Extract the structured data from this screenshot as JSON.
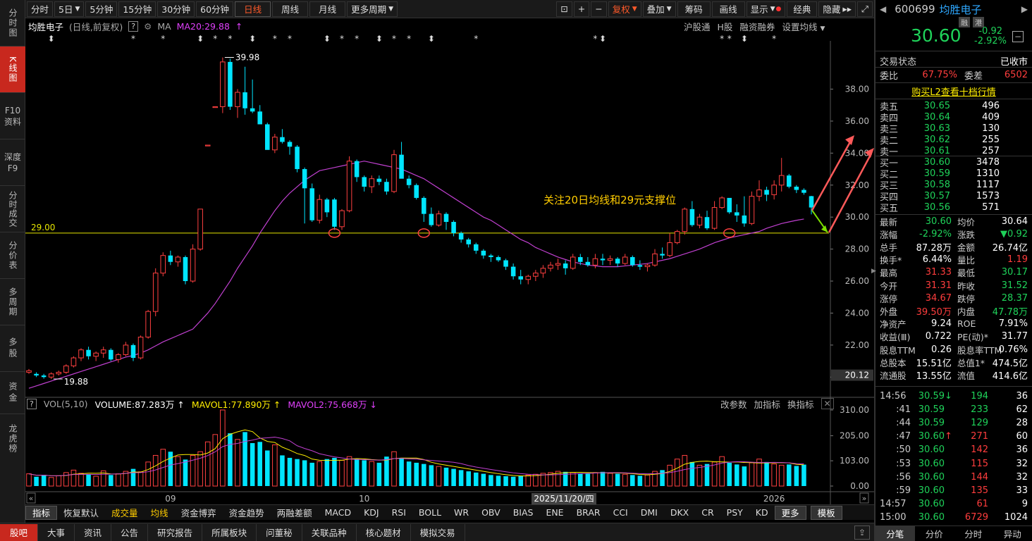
{
  "nav": [
    {
      "label": "分时图",
      "active": false
    },
    {
      "label": "K线图",
      "active": true
    },
    {
      "label": "F10资料",
      "active": false
    },
    {
      "label": "深度F9",
      "active": false
    },
    {
      "label": "分时成交",
      "active": false
    },
    {
      "label": "分价表",
      "active": false
    },
    {
      "label": "多周期",
      "active": false
    },
    {
      "label": "多股",
      "active": false
    },
    {
      "label": "资金",
      "active": false
    },
    {
      "label": "龙虎榜",
      "active": false
    }
  ],
  "toolbar": {
    "periods": [
      "分时",
      "5日",
      "5分钟",
      "15分钟",
      "30分钟",
      "60分钟",
      "日线",
      "周线",
      "月线",
      "更多周期"
    ],
    "active_period": "日线",
    "right": [
      "复权",
      "叠加",
      "筹码",
      "画线",
      "显示",
      "经典",
      "隐藏"
    ]
  },
  "stock": {
    "name": "均胜电子",
    "mode": "(日线,前复权)",
    "ma_label": "MA",
    "ma20": "MA20:29.88",
    "ma_color": "#e040fb",
    "options": [
      "沪股通",
      "H股",
      "融资融券",
      "设置均线"
    ]
  },
  "annotations": {
    "high": "39.98",
    "low": "19.88",
    "support": "29.00",
    "current": "20.12",
    "text": "关注20日均线和29元支撑位"
  },
  "vol": {
    "label": "VOL(5,10)",
    "volume": "VOLUME:87.283万",
    "mavol1": "MAVOL1:77.890万",
    "mavol2": "MAVOL2:75.668万",
    "options": [
      "改参数",
      "加指标",
      "换指标"
    ]
  },
  "xlabels": {
    "m09": "09",
    "m10": "10",
    "m11": "11",
    "date": "2025/11/20/四",
    "y2026": "2026"
  },
  "chart_data": {
    "type": "candlestick",
    "y_ticks": [
      38,
      36,
      34,
      32,
      30,
      28,
      26,
      24,
      22,
      20
    ],
    "ylim": [
      19,
      40.4
    ],
    "vol_ticks": [
      "310.00",
      "205.00",
      "103.00",
      "0.00"
    ],
    "vol_max": 310,
    "candles": [
      [
        20.3,
        20.5,
        20.2,
        20.4
      ],
      [
        20.2,
        20.3,
        20.0,
        20.1
      ],
      [
        20.1,
        20.2,
        19.9,
        20.0
      ],
      [
        20.0,
        20.3,
        19.88,
        20.2
      ],
      [
        20.2,
        20.4,
        20.1,
        20.3
      ],
      [
        20.3,
        20.8,
        20.2,
        20.7
      ],
      [
        20.7,
        21.3,
        20.6,
        21.2
      ],
      [
        21.2,
        21.8,
        21.0,
        21.7
      ],
      [
        21.7,
        21.9,
        21.1,
        21.3
      ],
      [
        21.3,
        21.6,
        21.0,
        21.5
      ],
      [
        21.5,
        21.9,
        21.2,
        21.7
      ],
      [
        21.7,
        21.8,
        21.0,
        21.1
      ],
      [
        21.1,
        21.5,
        20.9,
        21.4
      ],
      [
        21.4,
        22.2,
        21.3,
        22.0
      ],
      [
        22.0,
        22.1,
        21.0,
        21.2
      ],
      [
        21.2,
        22.6,
        21.1,
        22.5
      ],
      [
        22.5,
        24.2,
        22.4,
        24.1
      ],
      [
        24.1,
        26.8,
        23.8,
        26.5
      ],
      [
        26.5,
        27.8,
        26.3,
        27.6
      ],
      [
        27.6,
        27.9,
        27.0,
        27.2
      ],
      [
        27.2,
        27.6,
        26.9,
        27.5
      ],
      [
        27.5,
        27.6,
        25.8,
        26.0
      ],
      [
        26.0,
        28.3,
        25.9,
        28.0
      ],
      [
        28.0,
        30.5,
        27.9,
        30.5
      ],
      [
        34.5,
        34.5,
        34.5,
        34.5
      ],
      [
        36.9,
        36.9,
        36.9,
        36.9
      ],
      [
        36.9,
        39.98,
        36.5,
        39.7
      ],
      [
        39.7,
        39.9,
        36.7,
        36.9
      ],
      [
        36.9,
        38.0,
        36.2,
        37.8
      ],
      [
        37.8,
        39.4,
        36.4,
        36.8
      ],
      [
        36.8,
        38.6,
        36.5,
        36.6
      ],
      [
        36.6,
        37.0,
        35.8,
        35.8
      ],
      [
        35.8,
        35.9,
        34.3,
        34.2
      ],
      [
        34.2,
        35.2,
        34.0,
        35.0
      ],
      [
        35.0,
        35.5,
        34.6,
        34.7
      ],
      [
        34.7,
        34.8,
        33.9,
        34.4
      ],
      [
        34.4,
        34.5,
        32.8,
        33.0
      ],
      [
        33.0,
        33.1,
        29.6,
        31.8
      ],
      [
        31.8,
        32.1,
        29.7,
        29.8
      ],
      [
        29.8,
        31.4,
        29.6,
        31.1
      ],
      [
        31.1,
        31.2,
        30.0,
        30.3
      ],
      [
        31.1,
        31.2,
        29.2,
        29.4
      ],
      [
        29.4,
        30.5,
        29.2,
        30.4
      ],
      [
        30.4,
        33.8,
        30.3,
        33.5
      ],
      [
        33.5,
        33.6,
        32.2,
        32.5
      ],
      [
        32.5,
        32.6,
        31.6,
        31.9
      ],
      [
        31.9,
        32.6,
        31.5,
        32.4
      ],
      [
        32.4,
        32.6,
        32.0,
        32.2
      ],
      [
        32.2,
        32.4,
        31.4,
        31.6
      ],
      [
        31.6,
        34.2,
        31.5,
        33.9
      ],
      [
        33.9,
        34.7,
        32.7,
        32.4
      ],
      [
        32.4,
        32.6,
        31.8,
        32.0
      ],
      [
        32.0,
        32.1,
        31.1,
        31.2
      ],
      [
        31.2,
        31.3,
        29.7,
        30.2
      ],
      [
        30.2,
        30.6,
        29.4,
        29.5
      ],
      [
        29.5,
        30.4,
        29.4,
        30.2
      ],
      [
        30.2,
        30.3,
        29.2,
        29.7
      ],
      [
        29.7,
        29.8,
        28.8,
        29.0
      ],
      [
        29.0,
        29.1,
        28.4,
        28.6
      ],
      [
        28.6,
        28.7,
        28.1,
        28.3
      ],
      [
        28.3,
        28.4,
        27.7,
        27.9
      ],
      [
        27.9,
        28.0,
        27.4,
        27.6
      ],
      [
        27.6,
        27.7,
        27.2,
        27.5
      ],
      [
        27.5,
        27.6,
        27.2,
        27.3
      ],
      [
        27.3,
        27.4,
        26.7,
        26.9
      ],
      [
        26.9,
        27.1,
        26.1,
        26.3
      ],
      [
        26.3,
        26.7,
        25.8,
        26.1
      ],
      [
        26.1,
        26.4,
        25.8,
        26.3
      ],
      [
        26.3,
        26.7,
        26.0,
        26.5
      ],
      [
        26.5,
        27.0,
        26.2,
        26.8
      ],
      [
        26.8,
        27.2,
        26.6,
        27.0
      ],
      [
        27.0,
        27.4,
        26.7,
        27.1
      ],
      [
        27.1,
        27.3,
        26.4,
        26.8
      ],
      [
        26.8,
        27.7,
        26.7,
        27.5
      ],
      [
        27.5,
        27.7,
        27.0,
        27.2
      ],
      [
        27.2,
        27.5,
        26.9,
        27.0
      ],
      [
        27.0,
        27.7,
        26.8,
        27.4
      ],
      [
        27.4,
        27.7,
        27.0,
        27.3
      ],
      [
        27.3,
        27.6,
        27.0,
        27.4
      ],
      [
        27.4,
        27.5,
        26.9,
        27.1
      ],
      [
        27.1,
        27.7,
        27.0,
        27.5
      ],
      [
        27.5,
        27.6,
        26.9,
        27.0
      ],
      [
        27.0,
        27.3,
        26.7,
        26.9
      ],
      [
        26.9,
        27.1,
        26.6,
        27.0
      ],
      [
        27.0,
        28.0,
        26.9,
        27.7
      ],
      [
        27.7,
        28.1,
        27.4,
        27.6
      ],
      [
        27.6,
        29.0,
        27.5,
        28.4
      ],
      [
        28.4,
        29.2,
        28.3,
        29.1
      ],
      [
        29.1,
        30.6,
        28.9,
        30.5
      ],
      [
        30.5,
        31.0,
        29.4,
        29.5
      ],
      [
        29.5,
        30.2,
        29.3,
        30.0
      ],
      [
        30.0,
        30.4,
        29.2,
        29.3
      ],
      [
        29.3,
        31.0,
        29.2,
        30.6
      ],
      [
        30.6,
        31.3,
        30.5,
        31.2
      ],
      [
        31.2,
        30.4,
        30.2,
        30.3
      ],
      [
        30.3,
        30.8,
        29.7,
        30.1
      ],
      [
        30.1,
        31.3,
        29.4,
        29.6
      ],
      [
        29.6,
        31.6,
        29.5,
        31.3
      ],
      [
        31.3,
        32.3,
        31.0,
        31.7
      ],
      [
        31.7,
        31.9,
        31.0,
        31.4
      ],
      [
        31.4,
        32.3,
        31.1,
        32.0
      ],
      [
        32.0,
        33.7,
        31.6,
        32.6
      ],
      [
        32.6,
        32.7,
        31.8,
        31.9
      ],
      [
        31.9,
        32.0,
        31.5,
        31.7
      ],
      [
        31.7,
        31.8,
        31.4,
        31.52
      ],
      [
        31.31,
        31.33,
        30.17,
        30.6
      ]
    ],
    "ma20": [
      19.3,
      19.45,
      19.6,
      19.75,
      19.9,
      20.05,
      20.2,
      20.35,
      20.5,
      20.65,
      20.8,
      20.95,
      21.1,
      21.25,
      21.35,
      21.5,
      21.7,
      21.95,
      22.2,
      22.4,
      22.6,
      22.8,
      23.0,
      23.5,
      24.0,
      24.6,
      25.3,
      26.0,
      26.8,
      27.5,
      28.2,
      29.0,
      29.7,
      30.4,
      31.0,
      31.5,
      31.9,
      32.3,
      32.6,
      32.9,
      33.0,
      33.1,
      33.2,
      33.3,
      33.4,
      33.5,
      33.4,
      33.3,
      33.2,
      33.1,
      33.0,
      32.8,
      32.6,
      32.4,
      32.1,
      31.8,
      31.5,
      31.2,
      30.9,
      30.6,
      30.3,
      30.0,
      29.8,
      29.5,
      29.2,
      28.9,
      28.6,
      28.4,
      28.1,
      27.9,
      27.7,
      27.5,
      27.35,
      27.2,
      27.1,
      27.0,
      26.95,
      26.9,
      26.9,
      26.9,
      26.95,
      27.0,
      27.05,
      27.1,
      27.2,
      27.3,
      27.4,
      27.55,
      27.7,
      27.85,
      28.0,
      28.2,
      28.4,
      28.55,
      28.7,
      28.8,
      28.9,
      29.0,
      29.1,
      29.3,
      29.45,
      29.6,
      29.7,
      29.8,
      29.88
    ],
    "volume": [
      50,
      38,
      45,
      35,
      42,
      55,
      65,
      52,
      48,
      40,
      62,
      45,
      50,
      60,
      70,
      58,
      98,
      125,
      150,
      140,
      120,
      108,
      125,
      140,
      180,
      210,
      310,
      215,
      190,
      220,
      175,
      180,
      145,
      168,
      125,
      115,
      110,
      105,
      95,
      100,
      110,
      115,
      105,
      120,
      110,
      105,
      100,
      95,
      120,
      140,
      115,
      100,
      95,
      90,
      85,
      80,
      75,
      70,
      65,
      60,
      55,
      50,
      45,
      42,
      40,
      38,
      42,
      45,
      48,
      52,
      55,
      60,
      58,
      55,
      52,
      50,
      55,
      58,
      52,
      50,
      48,
      45,
      42,
      45,
      60,
      65,
      85,
      110,
      125,
      98,
      85,
      90,
      98,
      120,
      95,
      88,
      80,
      95,
      110,
      98,
      90,
      85,
      88,
      82,
      87.3
    ]
  },
  "rp": {
    "code": "600699",
    "name": "均胜电子",
    "tags": [
      "融",
      "港"
    ],
    "price": "30.60",
    "chg": "-0.92",
    "pct": "-2.92%",
    "status_label": "交易状态",
    "status": "已收市",
    "wb_label": "委比",
    "wb": "67.75%",
    "wc_label": "委差",
    "wc": "6502",
    "l2": "购买L2查看十档行情",
    "asks": [
      [
        "卖五",
        "30.65",
        "496"
      ],
      [
        "卖四",
        "30.64",
        "409"
      ],
      [
        "卖三",
        "30.63",
        "130"
      ],
      [
        "卖二",
        "30.62",
        "255"
      ],
      [
        "卖一",
        "30.61",
        "257"
      ]
    ],
    "bids": [
      [
        "买一",
        "30.60",
        "3478"
      ],
      [
        "买二",
        "30.59",
        "1310"
      ],
      [
        "买三",
        "30.58",
        "1117"
      ],
      [
        "买四",
        "30.57",
        "1573"
      ],
      [
        "买五",
        "30.56",
        "571"
      ]
    ],
    "stats": [
      [
        "最新",
        "30.60",
        "均价",
        "30.64"
      ],
      [
        "涨幅",
        "-2.92%",
        "涨跌",
        "▼0.92"
      ],
      [
        "总手",
        "87.28万",
        "金额",
        "26.74亿"
      ],
      [
        "换手*",
        "6.44%",
        "量比",
        "1.19"
      ],
      [
        "最高",
        "31.33",
        "最低",
        "30.17"
      ],
      [
        "今开",
        "31.31",
        "昨收",
        "31.52"
      ],
      [
        "涨停",
        "34.67",
        "跌停",
        "28.37"
      ],
      [
        "外盘",
        "39.50万",
        "内盘",
        "47.78万"
      ],
      [
        "净资产",
        "9.24",
        "ROE",
        "7.91%"
      ],
      [
        "收益(Ⅲ)",
        "0.722",
        "PE(动)*",
        "31.77"
      ],
      [
        "股息TTM",
        "0.26",
        "股息率TTM",
        "0.76%"
      ],
      [
        "总股本",
        "15.51亿",
        "总值1*",
        "474.5亿"
      ],
      [
        "流通股",
        "13.55亿",
        "流值",
        "414.6亿"
      ]
    ],
    "trades": [
      [
        "14:56",
        "30.59",
        "↓",
        "194",
        "36"
      ],
      [
        ":41",
        "30.59",
        "",
        "233",
        "62"
      ],
      [
        ":44",
        "30.59",
        "",
        "129",
        "28"
      ],
      [
        ":47",
        "30.60",
        "↑",
        "271",
        "60"
      ],
      [
        ":50",
        "30.60",
        "",
        "142",
        "36"
      ],
      [
        ":53",
        "30.60",
        "",
        "115",
        "32"
      ],
      [
        ":56",
        "30.60",
        "",
        "144",
        "32"
      ],
      [
        ":59",
        "30.60",
        "",
        "135",
        "33"
      ],
      [
        "14:57",
        "30.60",
        "",
        "61",
        "9"
      ],
      [
        "15:00",
        "30.60",
        "",
        "6729",
        "1024"
      ]
    ],
    "tabs": [
      "分笔",
      "分价",
      "分时",
      "异动"
    ]
  },
  "bottom_tabs": [
    "指标",
    "恢复默认",
    "成交量",
    "均线",
    "资金博弈",
    "资金趋势",
    "两融差额",
    "MACD",
    "KDJ",
    "RSI",
    "BOLL",
    "WR",
    "OBV",
    "BIAS",
    "ENE",
    "BRAR",
    "CCI",
    "DMI",
    "DKX",
    "CR",
    "PSY",
    "KD",
    "更多",
    "模板"
  ],
  "footer_tabs": [
    "股吧",
    "大事",
    "资讯",
    "公告",
    "研究报告",
    "所属板块",
    "问董秘",
    "关联品种",
    "核心题材",
    "模拟交易"
  ]
}
